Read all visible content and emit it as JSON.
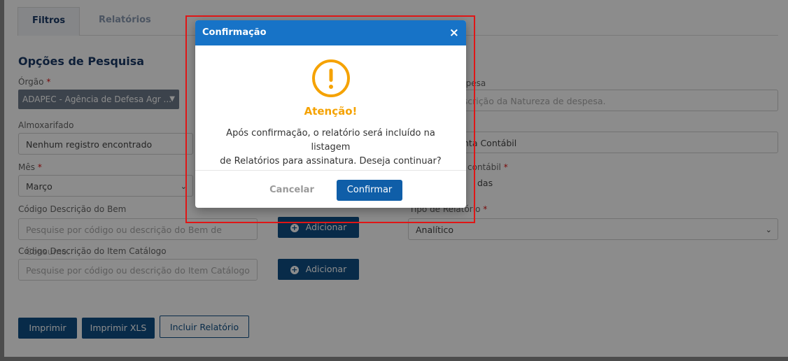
{
  "tabs": [
    {
      "label": "Filtros",
      "active": true
    },
    {
      "label": "Relatórios",
      "active": false
    }
  ],
  "section_title": "Opções de Pesquisa",
  "form": {
    "orgao_label": "Órgão",
    "orgao_value": "ADAPEC - Agência de Defesa Agr ...",
    "almox_label": "Almoxarifado",
    "almox_value": "Nenhum registro encontrado",
    "mes_label": "Mês",
    "mes_value": "Março",
    "bem_label": "Código Descrição do Bem",
    "bem_placeholder": "Pesquise por código ou descrição do Bem de Consumo.",
    "item_label": "Código Descrição do Item Catálogo",
    "item_placeholder": "Pesquise por código ou descrição do Item Catálogo",
    "add_label": "Adicionar",
    "natureza_label": "espesa",
    "natureza_placeholder": "escrição da Natureza de despesa.",
    "conta_value": "nta Contábil",
    "conta_label": "contábil",
    "todas_value": "das",
    "tipo_label": "Tipo de Relatório",
    "tipo_value": "Analítico",
    "required_mark": "*"
  },
  "actions": {
    "imprimir": "Imprimir",
    "imprimir_xls": "Imprimir XLS",
    "incluir": "Incluir Relatório"
  },
  "modal": {
    "title": "Confirmação",
    "close": "×",
    "heading": "Atenção!",
    "message_line1": "Após confirmação, o relatório será incluído na listagem",
    "message_line2": "de Relatórios para assinatura. Deseja continuar?",
    "cancel": "Cancelar",
    "confirm": "Confirmar",
    "warning_color": "#f5a200",
    "header_color": "#1773c7"
  }
}
